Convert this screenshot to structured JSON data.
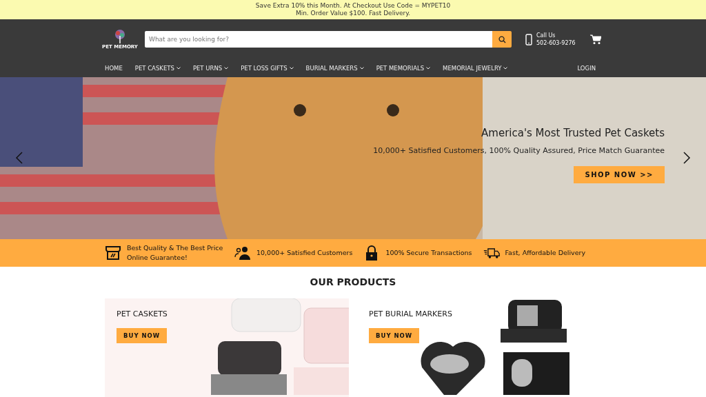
{
  "promo_bar": {
    "lines": [
      "Save Extra 10% this Month. At Checkout Use Code = MYPET10",
      "Min. Order Value $100. Fast Delivery."
    ]
  },
  "header": {
    "logo_text": "PET MEMORY",
    "search": {
      "placeholder": "What are you looking for?"
    },
    "contact": {
      "label": "Call Us",
      "phone": "502-603-9276"
    }
  },
  "nav": {
    "items": [
      {
        "label": "HOME",
        "dropdown": false
      },
      {
        "label": "PET CASKETS",
        "dropdown": true
      },
      {
        "label": "PET URNS",
        "dropdown": true
      },
      {
        "label": "PET LOSS GIFTS",
        "dropdown": true
      },
      {
        "label": "BURIAL MARKERS",
        "dropdown": true
      },
      {
        "label": "PET MEMORIALS",
        "dropdown": true
      },
      {
        "label": "MEMORIAL JEWELRY",
        "dropdown": true
      }
    ],
    "login": "LOGIN"
  },
  "hero": {
    "title": "America's Most Trusted Pet Caskets",
    "subtitle": "10,000+ Satisfied Customers, 100% Quality Assured, Price Match Guarantee",
    "button": "SHOP NOW >>"
  },
  "features": [
    {
      "kind": "store",
      "text": "Best Quality & The Best Price Online Guarantee!"
    },
    {
      "kind": "customers",
      "text": "10,000+ Satisfied Customers"
    },
    {
      "kind": "lock",
      "text": "100% Secure Transactions"
    },
    {
      "kind": "truck",
      "text": "Fast, Affordable Delivery"
    }
  ],
  "products": {
    "title": "OUR PRODUCTS",
    "items": [
      {
        "kind": "caskets",
        "name": "PET CASKETS",
        "button": "BUY NOW"
      },
      {
        "kind": "markers",
        "name": "PET BURIAL MARKERS",
        "button": "BUY NOW"
      }
    ]
  }
}
